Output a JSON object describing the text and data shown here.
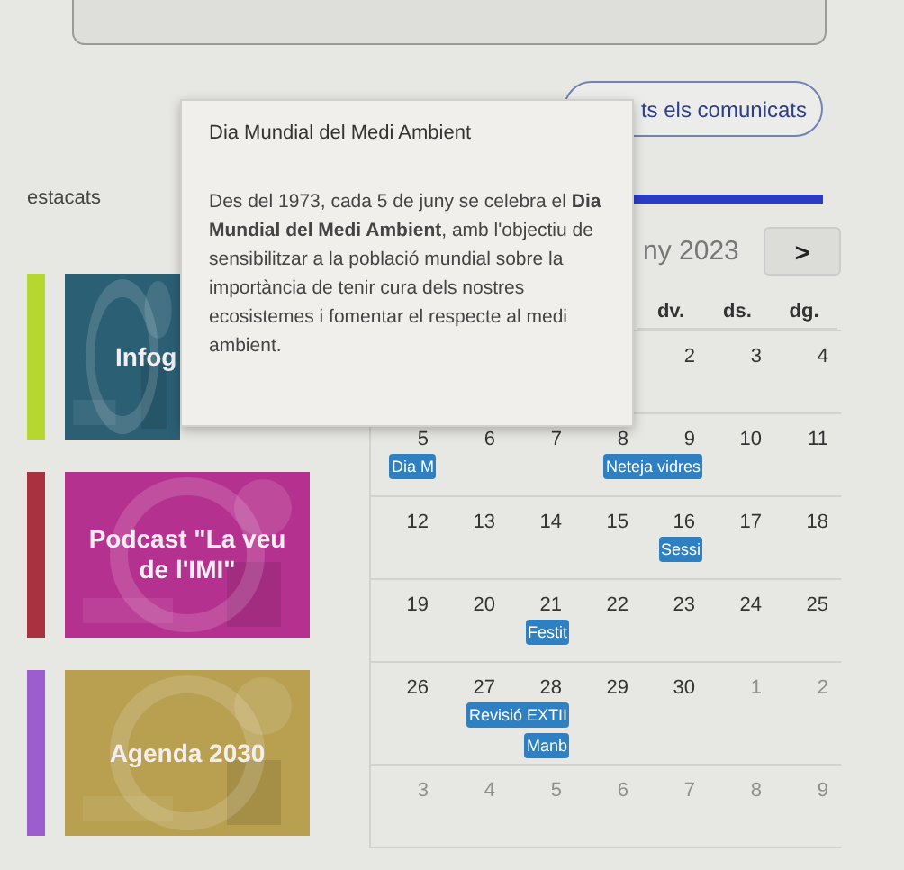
{
  "button": {
    "label": "ts els comunicats"
  },
  "section": {
    "label": "estacats"
  },
  "side_tiles": [
    {
      "color": "#b6d630"
    },
    {
      "color": "#a8323f"
    },
    {
      "color": "#9c5ecf"
    }
  ],
  "tiles": [
    {
      "title": "Infog",
      "color": "#2b5f74"
    },
    {
      "title": "Podcast \"La veu de l'IMI\"",
      "color": "#b5318f"
    },
    {
      "title": "Agenda 2030",
      "color": "#b8a050"
    }
  ],
  "calendar": {
    "title": "ny 2023",
    "next": ">",
    "weekdays": [
      {
        "label": "dv."
      },
      {
        "label": "ds."
      },
      {
        "label": "dg."
      }
    ],
    "weeks": [
      {
        "days": [
          {
            "day": "2",
            "muted": false
          },
          {
            "day": "3",
            "muted": false
          },
          {
            "day": "4",
            "muted": false
          }
        ]
      },
      {
        "days": [
          {
            "day": "5",
            "muted": false,
            "events": [
              {
                "label": "Dia M"
              }
            ]
          },
          {
            "day": "6",
            "muted": false
          },
          {
            "day": "7",
            "muted": false
          },
          {
            "day": "8",
            "muted": false,
            "events": [
              {
                "label": "Neteja vidres",
                "kind": "wide"
              }
            ]
          },
          {
            "day": "9",
            "muted": false
          },
          {
            "day": "10",
            "muted": false
          },
          {
            "day": "11",
            "muted": false
          }
        ]
      },
      {
        "days": [
          {
            "day": "12",
            "muted": false
          },
          {
            "day": "13",
            "muted": false
          },
          {
            "day": "14",
            "muted": false
          },
          {
            "day": "15",
            "muted": false
          },
          {
            "day": "16",
            "muted": false,
            "events": [
              {
                "label": "Sessi"
              }
            ]
          },
          {
            "day": "17",
            "muted": false
          },
          {
            "day": "18",
            "muted": false
          }
        ]
      },
      {
        "days": [
          {
            "day": "19",
            "muted": false
          },
          {
            "day": "20",
            "muted": false
          },
          {
            "day": "21",
            "muted": false,
            "events": [
              {
                "label": "Festit"
              }
            ]
          },
          {
            "day": "22",
            "muted": false
          },
          {
            "day": "23",
            "muted": false
          },
          {
            "day": "24",
            "muted": false
          },
          {
            "day": "25",
            "muted": false
          }
        ]
      },
      {
        "days": [
          {
            "day": "26",
            "muted": false
          },
          {
            "day": "27",
            "muted": false,
            "events": [
              {
                "label": "Revisió EXTII",
                "kind": "wide"
              }
            ]
          },
          {
            "day": "28",
            "muted": false,
            "events": [
              {
                "label": "Manb"
              }
            ]
          },
          {
            "day": "29",
            "muted": false
          },
          {
            "day": "30",
            "muted": false
          },
          {
            "day": "1",
            "muted": true
          },
          {
            "day": "2",
            "muted": true
          }
        ]
      },
      {
        "days": [
          {
            "day": "3",
            "muted": true
          },
          {
            "day": "4",
            "muted": true
          },
          {
            "day": "5",
            "muted": true
          },
          {
            "day": "6",
            "muted": true
          },
          {
            "day": "7",
            "muted": true
          },
          {
            "day": "8",
            "muted": true
          },
          {
            "day": "9",
            "muted": true
          }
        ]
      }
    ]
  },
  "tooltip": {
    "title": "Dia Mundial del Medi Ambient",
    "body": "Des del 1973, cada 5 de juny se celebra el **Dia Mundial del Medi Ambient**, amb l'objectiu de sensibilitzar a la població mundial sobre la importància de tenir cura dels nostres ecosistemes i fomentar el respecte al medi ambient."
  }
}
